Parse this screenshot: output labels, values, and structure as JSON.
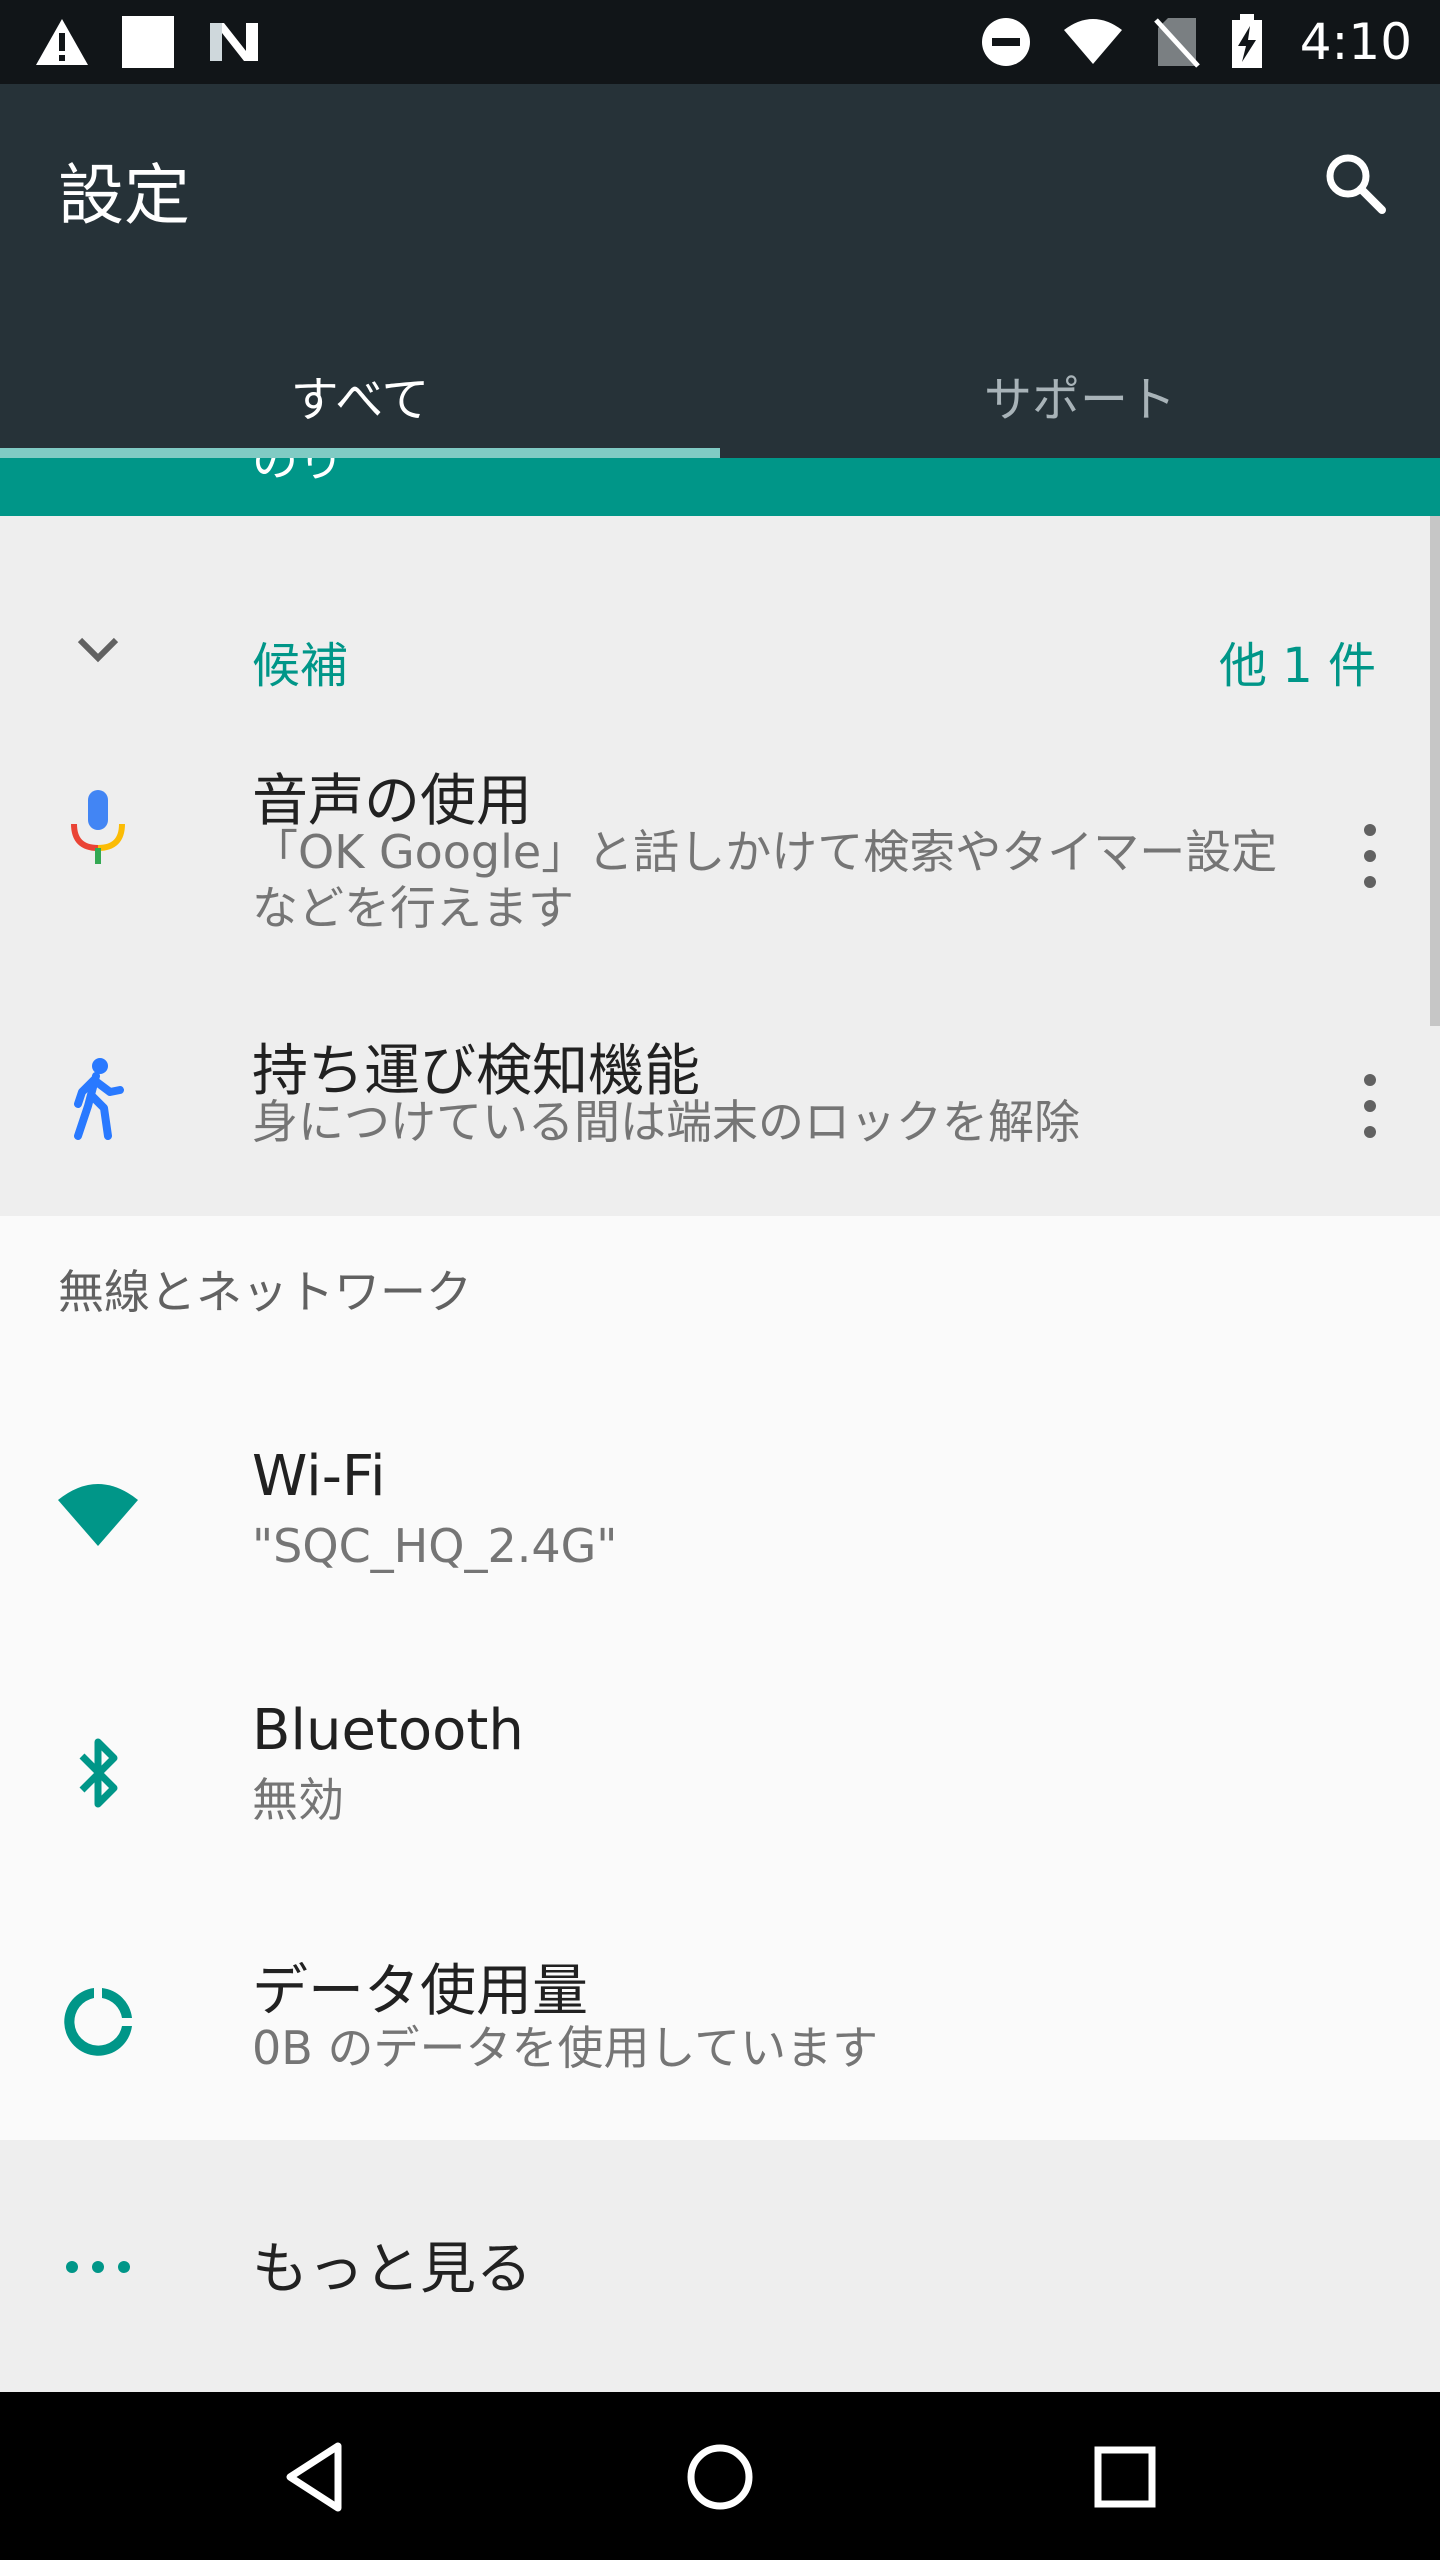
{
  "status_bar": {
    "time": "4:10",
    "left_icons": [
      "warning-icon",
      "square-notification-icon",
      "n-logo-icon"
    ],
    "right_icons": [
      "do-not-disturb-icon",
      "wifi-icon",
      "no-sim-icon",
      "battery-charging-icon"
    ]
  },
  "app_bar": {
    "title": "設定",
    "search_icon": "search-icon"
  },
  "tabs": [
    {
      "label": "すべて",
      "active": true
    },
    {
      "label": "サポート",
      "active": false
    }
  ],
  "teal_banner": {
    "partial_text": "のり"
  },
  "suggestions": {
    "title": "候補",
    "more_count": "他 1 件",
    "items": [
      {
        "title": "音声の使用",
        "subtitle": "「OK Google」と話しかけて検索やタイマー設定などを行えます",
        "icon": "microphone-icon"
      },
      {
        "title": "持ち運び検知機能",
        "subtitle": "身につけている間は端末のロックを解除",
        "icon": "walking-person-icon"
      }
    ]
  },
  "section": {
    "header": "無線とネットワーク",
    "items": [
      {
        "title": "Wi-Fi",
        "subtitle": "\"SQC_HQ_2.4G\"",
        "icon": "wifi-icon"
      },
      {
        "title": "Bluetooth",
        "subtitle": "無効",
        "icon": "bluetooth-icon"
      },
      {
        "title": "データ使用量",
        "subtitle": "0B のデータを使用しています",
        "icon": "data-usage-icon"
      }
    ]
  },
  "more": {
    "label": "もっと見る",
    "icon": "more-horiz-icon"
  },
  "nav_bar": {
    "buttons": [
      "back-icon",
      "home-icon",
      "recents-icon"
    ]
  },
  "colors": {
    "accent": "#009688",
    "app_bar": "#263238",
    "tab_indicator": "#80cbc4",
    "suggestion_bg": "#eeeeee",
    "page_bg": "#fafafa"
  }
}
